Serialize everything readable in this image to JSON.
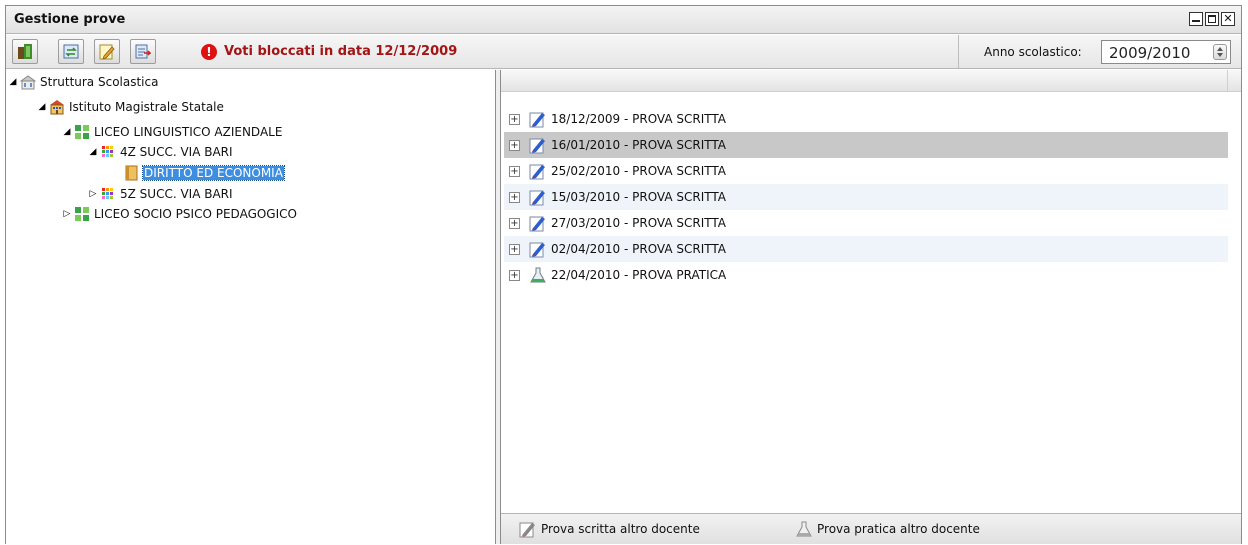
{
  "window": {
    "title": "Gestione prove"
  },
  "toolbar": {
    "warning_text": "Voti bloccati in data 12/12/2009",
    "year_label": "Anno scolastico:",
    "year_value": "2009/2010"
  },
  "tree": {
    "root": "Struttura Scolastica",
    "institute": "Istituto Magistrale Statale",
    "course1": "LICEO LINGUISTICO AZIENDALE",
    "class1": "4Z SUCC. VIA BARI",
    "subject": "DIRITTO ED ECONOMIA",
    "class2": "5Z SUCC. VIA BARI",
    "course2": "LICEO SOCIO PSICO PEDAGOGICO"
  },
  "tests": [
    {
      "label": "18/12/2009 - PROVA SCRITTA"
    },
    {
      "label": "16/01/2010 - PROVA SCRITTA"
    },
    {
      "label": "25/02/2010 - PROVA SCRITTA"
    },
    {
      "label": "15/03/2010 - PROVA SCRITTA"
    },
    {
      "label": "27/03/2010 - PROVA SCRITTA"
    },
    {
      "label": "02/04/2010 - PROVA SCRITTA"
    },
    {
      "label": "22/04/2010 - PROVA PRATICA"
    }
  ],
  "legend": {
    "written_other": "Prova scritta altro docente",
    "practical_other": "Prova pratica altro docente"
  },
  "colors": {
    "warning": "#a31414",
    "selection": "#3d8ee0",
    "row_selected": "#c8c8c8",
    "row_alt": "#eef4fa"
  }
}
